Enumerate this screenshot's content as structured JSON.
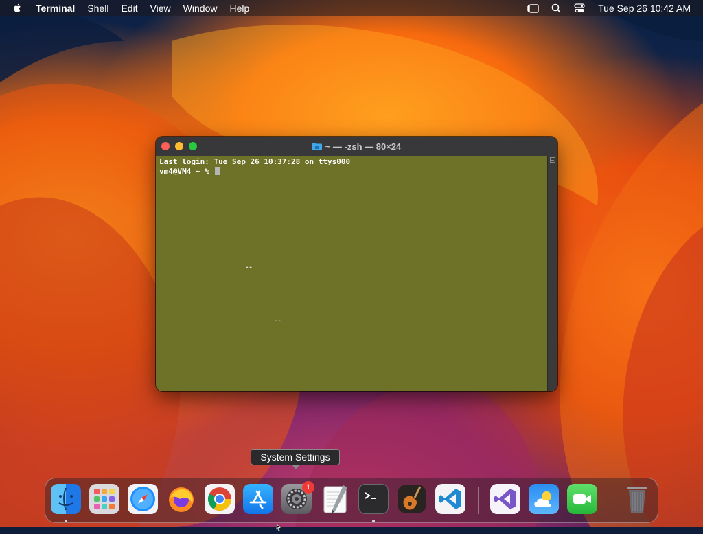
{
  "menubar": {
    "app_name": "Terminal",
    "items": [
      "Shell",
      "Edit",
      "View",
      "Window",
      "Help"
    ],
    "clock": "Tue Sep 26  10:42 AM"
  },
  "terminal": {
    "title": "~ — -zsh — 80×24",
    "lines": [
      "Last login: Tue Sep 26 10:37:28 on ttys000",
      "vm4@VM4 ~ % "
    ],
    "artifacts": [
      "--",
      "--"
    ],
    "background_color": "#6e7128"
  },
  "tooltip": {
    "label": "System Settings"
  },
  "dock": {
    "apps": [
      {
        "name": "Finder",
        "icon": "finder-icon",
        "running": true
      },
      {
        "name": "Launchpad",
        "icon": "launchpad-icon",
        "running": false
      },
      {
        "name": "Safari",
        "icon": "safari-icon",
        "running": false
      },
      {
        "name": "Firefox",
        "icon": "firefox-icon",
        "running": false
      },
      {
        "name": "Google Chrome",
        "icon": "chrome-icon",
        "running": false
      },
      {
        "name": "App Store",
        "icon": "app-store-icon",
        "running": false
      },
      {
        "name": "System Settings",
        "icon": "system-settings-icon",
        "running": false,
        "badge": "1"
      },
      {
        "name": "TextEdit",
        "icon": "textedit-icon",
        "running": false
      },
      {
        "name": "Terminal",
        "icon": "terminal-icon",
        "running": true
      },
      {
        "name": "GarageBand",
        "icon": "garageband-icon",
        "running": false
      },
      {
        "name": "Visual Studio Code",
        "icon": "vscode-icon",
        "running": false
      },
      {
        "name": "Visual Studio",
        "icon": "visual-studio-icon",
        "running": false
      },
      {
        "name": "Weather",
        "icon": "weather-icon",
        "running": false
      },
      {
        "name": "FaceTime",
        "icon": "facetime-icon",
        "running": false
      },
      {
        "name": "Trash",
        "icon": "trash-icon",
        "running": false
      }
    ]
  }
}
